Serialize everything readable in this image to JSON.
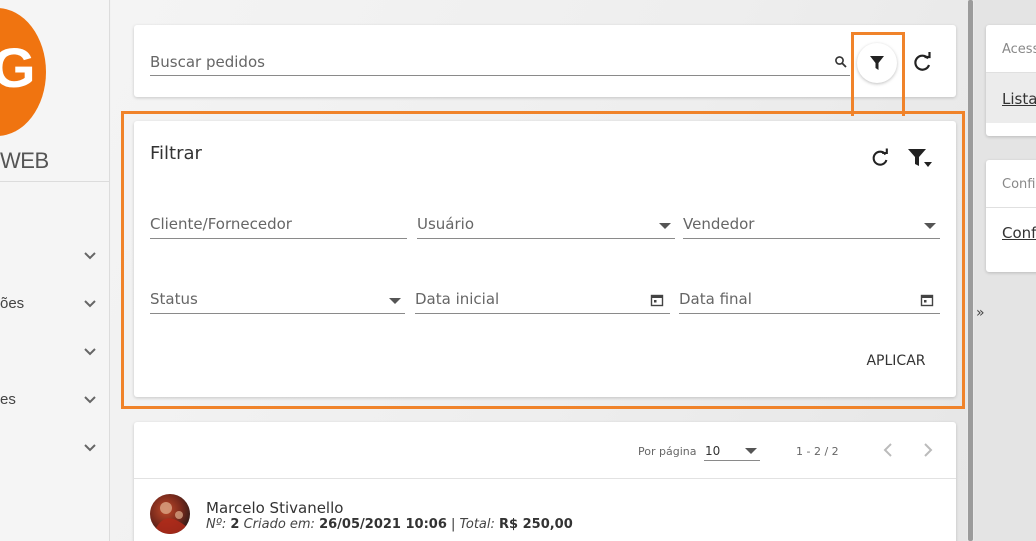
{
  "sidebar": {
    "logo_letter": "G",
    "logo_text": "WEB",
    "items": [
      {
        "label": ""
      },
      {
        "label": "ões"
      },
      {
        "label": ""
      },
      {
        "label": "es"
      },
      {
        "label": ""
      }
    ]
  },
  "search": {
    "placeholder": "Buscar pedidos",
    "value": ""
  },
  "filter": {
    "title": "Filtrar",
    "fields": {
      "client": "Cliente/Fornecedor",
      "user": "Usuário",
      "seller": "Vendedor",
      "status": "Status",
      "date_start": "Data inicial",
      "date_end": "Data final"
    },
    "apply_label": "APLICAR"
  },
  "list": {
    "per_page_label": "Por página",
    "per_page_value": "10",
    "range": "1 - 2 / 2",
    "orders": [
      {
        "name": "Marcelo Stivanello",
        "number_label": "Nº:",
        "number": "2",
        "created_label": "Criado em:",
        "created": "26/05/2021 10:06",
        "separator": "|",
        "total_label": "Total:",
        "total": "R$ 250,00"
      }
    ]
  },
  "right_panel": {
    "collapse_glyph": "»",
    "section1": {
      "header": "Acesso",
      "link": "Lista"
    },
    "section2": {
      "header": "Config",
      "link": "Config"
    }
  },
  "colors": {
    "brand": "#f07410",
    "highlight": "#f0832a"
  }
}
